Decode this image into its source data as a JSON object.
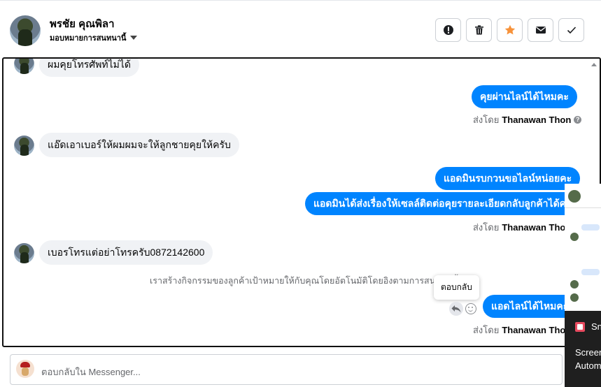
{
  "header": {
    "name": "พรชัย คุณพิลา",
    "assign_label": "มอบหมายการสนทนานี้",
    "actions": [
      {
        "name": "alert-button",
        "icon": "alert-icon"
      },
      {
        "name": "delete-button",
        "icon": "trash-icon"
      },
      {
        "name": "star-button",
        "icon": "star-icon"
      },
      {
        "name": "mail-button",
        "icon": "envelope-icon"
      },
      {
        "name": "done-button",
        "icon": "check-icon"
      }
    ]
  },
  "messages": {
    "m1": "ผมคุยโทรศัพท์ไม่ได้",
    "m2": "คุยผ่านไลน์ได้ไหมคะ",
    "m3": "แอ๊ดเอาเบอร์ให้ผมผมจะให้ลูกชายคุยให้ครับ",
    "m4": "แอดมินรบกวนขอไลน์หน่อยคะ",
    "m5": "แอดมินได้ส่งเรื่องให้เซลล์ติดต่อคุยรายละเอียดกลับลูกค้าได้คะ",
    "m6": "เบอรโทรแต่อย่าโทรครับ0872142600",
    "m7": "แอดไลน์ได้ไหมคะ"
  },
  "sent_by": {
    "prefix": "ส่งโดย",
    "agent": "Thanawan Thon"
  },
  "notice": "เราสร้างกิจกรรมของลูกค้าเป้าหมายให้กับคุณโดยอัตโนมัติโดยอิงตามการสนทนานี้",
  "tooltip": "ตอบกลับ",
  "composer": {
    "placeholder": "ตอบกลับใน Messenger..."
  },
  "overlay": {
    "snip_label": "Sn",
    "line1": "Screen",
    "line2": "Autom"
  },
  "colors": {
    "outgoing_bubble": "#0084ff",
    "incoming_bubble": "#f0f2f5",
    "star": "#f7923a"
  }
}
